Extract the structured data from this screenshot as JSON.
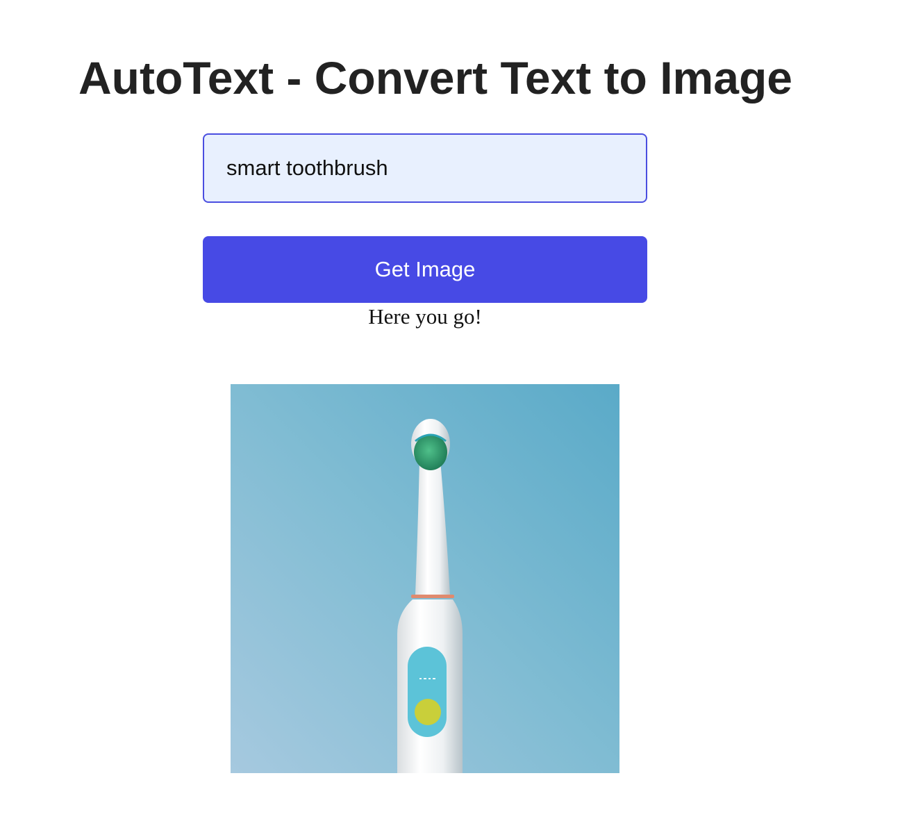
{
  "header": {
    "title": "AutoText - Convert Text to Image"
  },
  "form": {
    "input_value": "smart toothbrush",
    "button_label": "Get Image"
  },
  "result": {
    "message": "Here you go!",
    "image_subject": "electric-toothbrush-image"
  },
  "colors": {
    "title_text": "#222222",
    "input_border": "#4a4ee0",
    "input_background": "#e8f0fe",
    "button_background": "#474ae5",
    "button_text": "#ffffff",
    "image_background": "#7fb9d3"
  }
}
